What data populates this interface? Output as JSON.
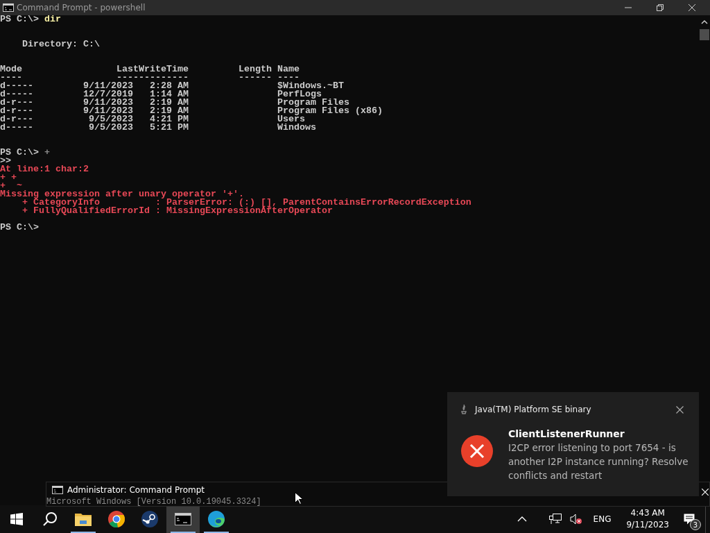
{
  "window": {
    "title": "Command Prompt - powershell"
  },
  "console": {
    "lines": [
      {
        "kind": "prompt",
        "prompt": "PS C:\\>",
        "command": "dir",
        "color": "#f9f1a5"
      },
      {
        "kind": "blank"
      },
      {
        "kind": "blank"
      },
      {
        "kind": "output",
        "text": "    Directory: C:\\"
      },
      {
        "kind": "blank"
      },
      {
        "kind": "blank"
      },
      {
        "kind": "output",
        "text": "Mode                 LastWriteTime         Length Name"
      },
      {
        "kind": "output",
        "text": "----                 -------------         ------ ----"
      },
      {
        "kind": "output",
        "text": "d-----         9/11/2023   2:28 AM                $Windows.~BT"
      },
      {
        "kind": "output",
        "text": "d-----         12/7/2019   1:14 AM                PerfLogs"
      },
      {
        "kind": "output",
        "text": "d-r---         9/11/2023   2:19 AM                Program Files"
      },
      {
        "kind": "output",
        "text": "d-r---         9/11/2023   2:19 AM                Program Files (x86)"
      },
      {
        "kind": "output",
        "text": "d-r---          9/5/2023   4:21 PM                Users"
      },
      {
        "kind": "output",
        "text": "d-----          9/5/2023   5:21 PM                Windows"
      },
      {
        "kind": "blank"
      },
      {
        "kind": "blank"
      },
      {
        "kind": "prompt",
        "prompt": "PS C:\\>",
        "command": "+",
        "color": "#8a8a8a"
      },
      {
        "kind": "output",
        "text": ">>"
      },
      {
        "kind": "error",
        "text": "At line:1 char:2"
      },
      {
        "kind": "error",
        "text": "+ +"
      },
      {
        "kind": "error",
        "text": "+  ~"
      },
      {
        "kind": "error",
        "text": "Missing expression after unary operator '+'."
      },
      {
        "kind": "error",
        "text": "    + CategoryInfo          : ParserError: (:) [], ParentContainsErrorRecordException"
      },
      {
        "kind": "error",
        "text": "    + FullyQualifiedErrorId : MissingExpressionAfterOperator"
      },
      {
        "kind": "blank"
      },
      {
        "kind": "output",
        "text": "PS C:\\>"
      }
    ]
  },
  "notification": {
    "app": "Java(TM) Platform SE binary",
    "title": "ClientListenerRunner",
    "body": "I2CP error listening to port 7654 - is another I2P instance running? Resolve conflicts and restart"
  },
  "preview": {
    "title": "Administrator: Command Prompt",
    "text": "Microsoft Windows [Version 10.0.19045.3324]"
  },
  "taskbar": {
    "apps": [
      {
        "kind": "start",
        "running": false,
        "selected": false
      },
      {
        "kind": "search",
        "running": false,
        "selected": false
      },
      {
        "kind": "folder",
        "running": true,
        "selected": false
      },
      {
        "kind": "chrome",
        "running": false,
        "selected": false
      },
      {
        "kind": "steam",
        "running": false,
        "selected": false
      },
      {
        "kind": "terminal",
        "running": true,
        "selected": true
      },
      {
        "kind": "edge",
        "running": true,
        "selected": false
      }
    ],
    "language": "ENG",
    "time": "4:43 AM",
    "date": "9/11/2023",
    "notification_count": "3"
  }
}
